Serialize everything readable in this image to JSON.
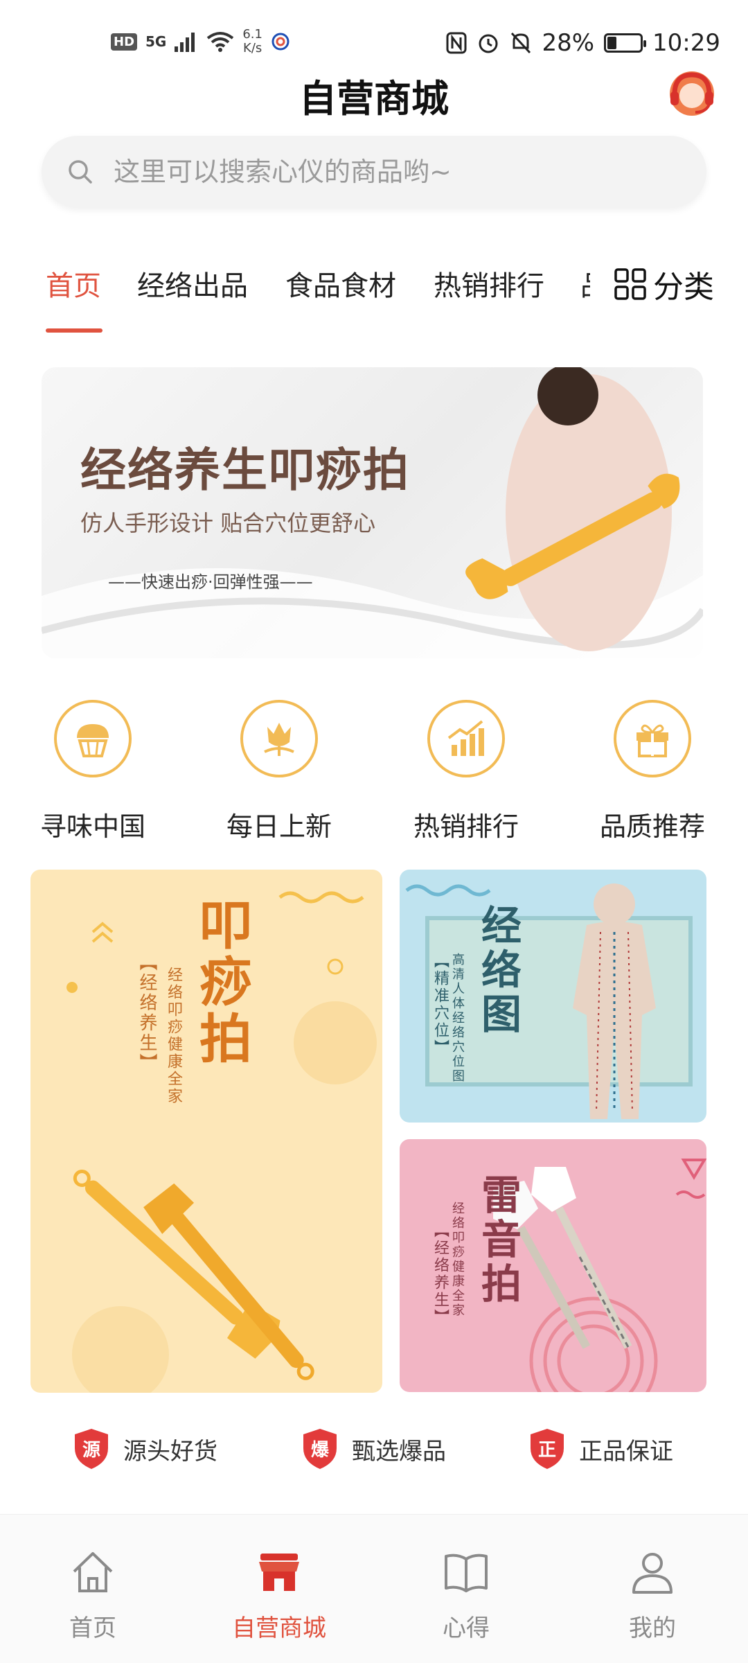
{
  "status_bar": {
    "hd": "HD",
    "network": "5G",
    "speed_value": "6.1",
    "speed_unit": "K/s",
    "battery": "28%",
    "battery_level": 0.28,
    "time": "10:29"
  },
  "header": {
    "title": "自营商城"
  },
  "search": {
    "placeholder": "这里可以搜索心仪的商品哟~"
  },
  "tabs": {
    "items": [
      "首页",
      "经络出品",
      "食品食材",
      "热销排行"
    ],
    "clipped": "品",
    "active_index": 0,
    "category_label": "分类"
  },
  "banner": {
    "title": "经络养生叩痧拍",
    "subtitle": "仿人手形设计 贴合穴位更舒心",
    "tagline": "——快速出痧·回弹性强——"
  },
  "quick_categories": [
    {
      "label": "寻味中国",
      "icon": "cupcake-icon"
    },
    {
      "label": "每日上新",
      "icon": "tulip-icon"
    },
    {
      "label": "热销排行",
      "icon": "bar-chart-icon"
    },
    {
      "label": "品质推荐",
      "icon": "gift-icon"
    }
  ],
  "promos": {
    "left": {
      "title": "叩痧拍",
      "bracket": "【经络养生】",
      "desc": "经络叩痧健康全家"
    },
    "right_top": {
      "title": "经络图",
      "bracket": "【精准穴位】",
      "desc": "高清人体经络穴位图"
    },
    "right_bottom": {
      "title": "雷音拍",
      "bracket": "【经络养生】",
      "desc": "经络叩痧健康全家"
    }
  },
  "guarantees": [
    {
      "badge": "源",
      "label": "源头好货"
    },
    {
      "badge": "爆",
      "label": "甄选爆品"
    },
    {
      "badge": "正",
      "label": "正品保证"
    }
  ],
  "bottom_nav": [
    {
      "label": "首页",
      "icon": "home-icon"
    },
    {
      "label": "自营商城",
      "icon": "store-icon"
    },
    {
      "label": "心得",
      "icon": "book-icon"
    },
    {
      "label": "我的",
      "icon": "user-icon"
    }
  ],
  "colors": {
    "accent": "#e0533f",
    "quick_icon": "#f2bb55",
    "shield": "#e23b3b"
  }
}
